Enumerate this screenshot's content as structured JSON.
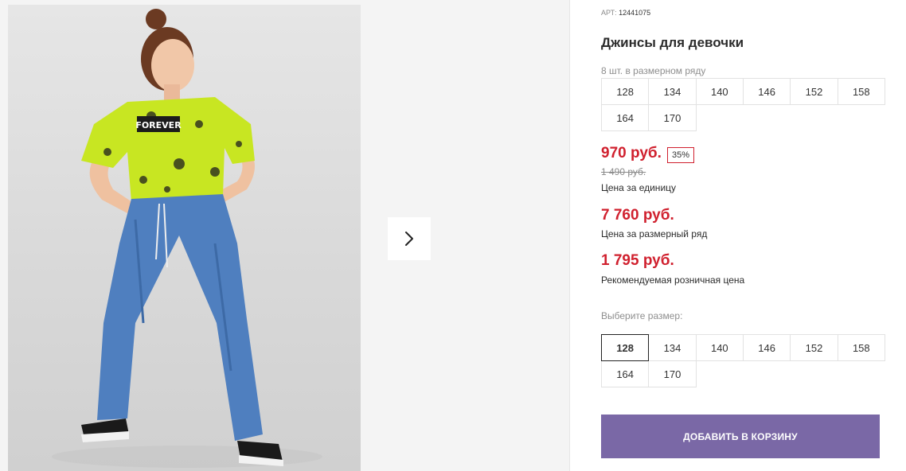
{
  "product": {
    "article_label": "АРТ:",
    "article_number": "12441075",
    "title": "Джинсы для девочки",
    "size_row_hint": "8 шт. в размерном ряду",
    "size_row": [
      "128",
      "134",
      "140",
      "146",
      "152",
      "158",
      "164",
      "170"
    ]
  },
  "pricing": {
    "unit_price": "970 руб.",
    "discount_badge": "35%",
    "old_price": "1 490 руб.",
    "unit_price_label": "Цена за единицу",
    "row_price": "7 760 руб.",
    "row_price_label": "Цена за размерный ряд",
    "retail_price": "1 795 руб.",
    "retail_price_label": "Рекомендуемая розничная цена"
  },
  "size_selector": {
    "label": "Выберите размер:",
    "options": [
      "128",
      "134",
      "140",
      "146",
      "152",
      "158",
      "164",
      "170"
    ],
    "selected": "128"
  },
  "actions": {
    "add_to_cart": "ДОБАВИТЬ В КОРЗИНУ"
  },
  "gallery": {
    "shirt_print_text": "FOREVER",
    "next_icon": "chevron-right-icon"
  },
  "colors": {
    "price_red": "#d0202e",
    "button_purple": "#7a68a6",
    "shirt_lime": "#c8e622",
    "denim_blue": "#4f7fbf"
  }
}
